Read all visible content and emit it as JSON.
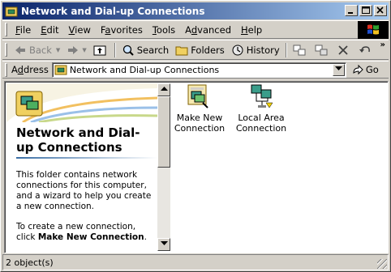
{
  "window": {
    "title": "Network and Dial-up Connections",
    "minimize": "_",
    "maximize": "□",
    "close": "×"
  },
  "menu": [
    {
      "key": "F",
      "rest": "ile"
    },
    {
      "key": "E",
      "rest": "dit"
    },
    {
      "key": "V",
      "rest": "iew"
    },
    {
      "key": "",
      "pre": "F",
      "u": "a",
      "rest": "vorites"
    },
    {
      "key": "T",
      "rest": "ools"
    },
    {
      "key": "",
      "pre": "A",
      "u": "d",
      "rest": "vanced"
    },
    {
      "key": "H",
      "rest": "elp"
    }
  ],
  "toolbar": {
    "back": "Back",
    "search": "Search",
    "folders": "Folders",
    "history": "History",
    "more": "»"
  },
  "address": {
    "label_key": "d",
    "label_pre": "A",
    "label_rest": "dress",
    "value": "Network and Dial-up Connections",
    "go": "Go"
  },
  "left_pane": {
    "title": "Network and Dial-up Connections",
    "description": "This folder contains network connections for this computer, and a wizard to help you create a new connection.",
    "create_text": "To create a new connection, click",
    "create_link": "Make New Connection",
    "create_end": "."
  },
  "items": [
    {
      "label_line1": "Make New",
      "label_line2": "Connection",
      "icon": "make-new-connection-icon"
    },
    {
      "label_line1": "Local Area",
      "label_line2": "Connection",
      "icon": "lan-connection-icon"
    }
  ],
  "status": {
    "text": "2 object(s)"
  },
  "colors": {
    "title_start": "#0a246a",
    "title_end": "#a6caf0",
    "face": "#d4d0c8"
  }
}
